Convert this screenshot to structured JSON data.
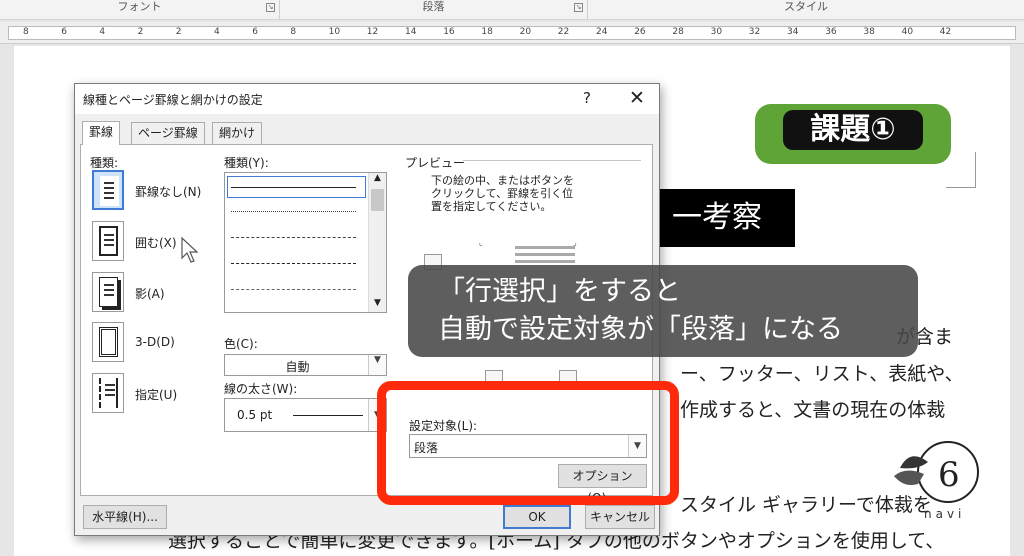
{
  "ribbon": {
    "groups": [
      "フォント",
      "段落",
      "スタイル"
    ]
  },
  "ruler": {
    "labels": [
      "8",
      "6",
      "4",
      "2",
      "2",
      "4",
      "6",
      "8",
      "10",
      "12",
      "14",
      "16",
      "18",
      "20",
      "22",
      "24",
      "26",
      "28",
      "30",
      "32",
      "34",
      "36",
      "38",
      "40",
      "42"
    ]
  },
  "document": {
    "badge_text": "課題①",
    "heading_text": "一考察",
    "lines": [
      "が含ま",
      "ー、フッター、リスト、表紙や、",
      "作成すると、文書の現在の体裁",
      "スタイル ギャラリーで体裁を",
      "選択することで簡単に変更できます。[ホーム] タブの他のボタンやオプションを使用して、"
    ]
  },
  "caption": {
    "line1": "「行選択」をすると",
    "line2": "自動で設定対象が「段落」になる"
  },
  "logo": {
    "text": "navi"
  },
  "dialog": {
    "title": "線種とページ罫線と網かけの設定",
    "help_label": "?",
    "close_label": "✕",
    "tabs": [
      "罫線",
      "ページ罫線",
      "網かけ"
    ],
    "active_tab": 0,
    "setting_label": "種類:",
    "settings": [
      "罫線なし(N)",
      "囲む(X)",
      "影(A)",
      "3-D(D)",
      "指定(U)"
    ],
    "selected_setting": 0,
    "style_label": "種類(Y):",
    "color_label": "色(C):",
    "color_value": "自動",
    "width_label": "線の太さ(W):",
    "width_value": "0.5 pt",
    "preview_label": "プレビュー",
    "preview_hint": "下の絵の中、またはボタンを\nクリックして、罫線を引く位\n置を指定してください。",
    "apply_to_label": "設定対象(L):",
    "apply_to_value": "段落",
    "options_button": "オプション(O)...",
    "horizontal_line_button": "水平線(H)...",
    "ok_button": "OK",
    "cancel_button": "キャンセル"
  },
  "colors": {
    "highlight": "#ff2a0b",
    "badge_green": "#5fa436",
    "selection_blue": "#3d7bd4"
  }
}
